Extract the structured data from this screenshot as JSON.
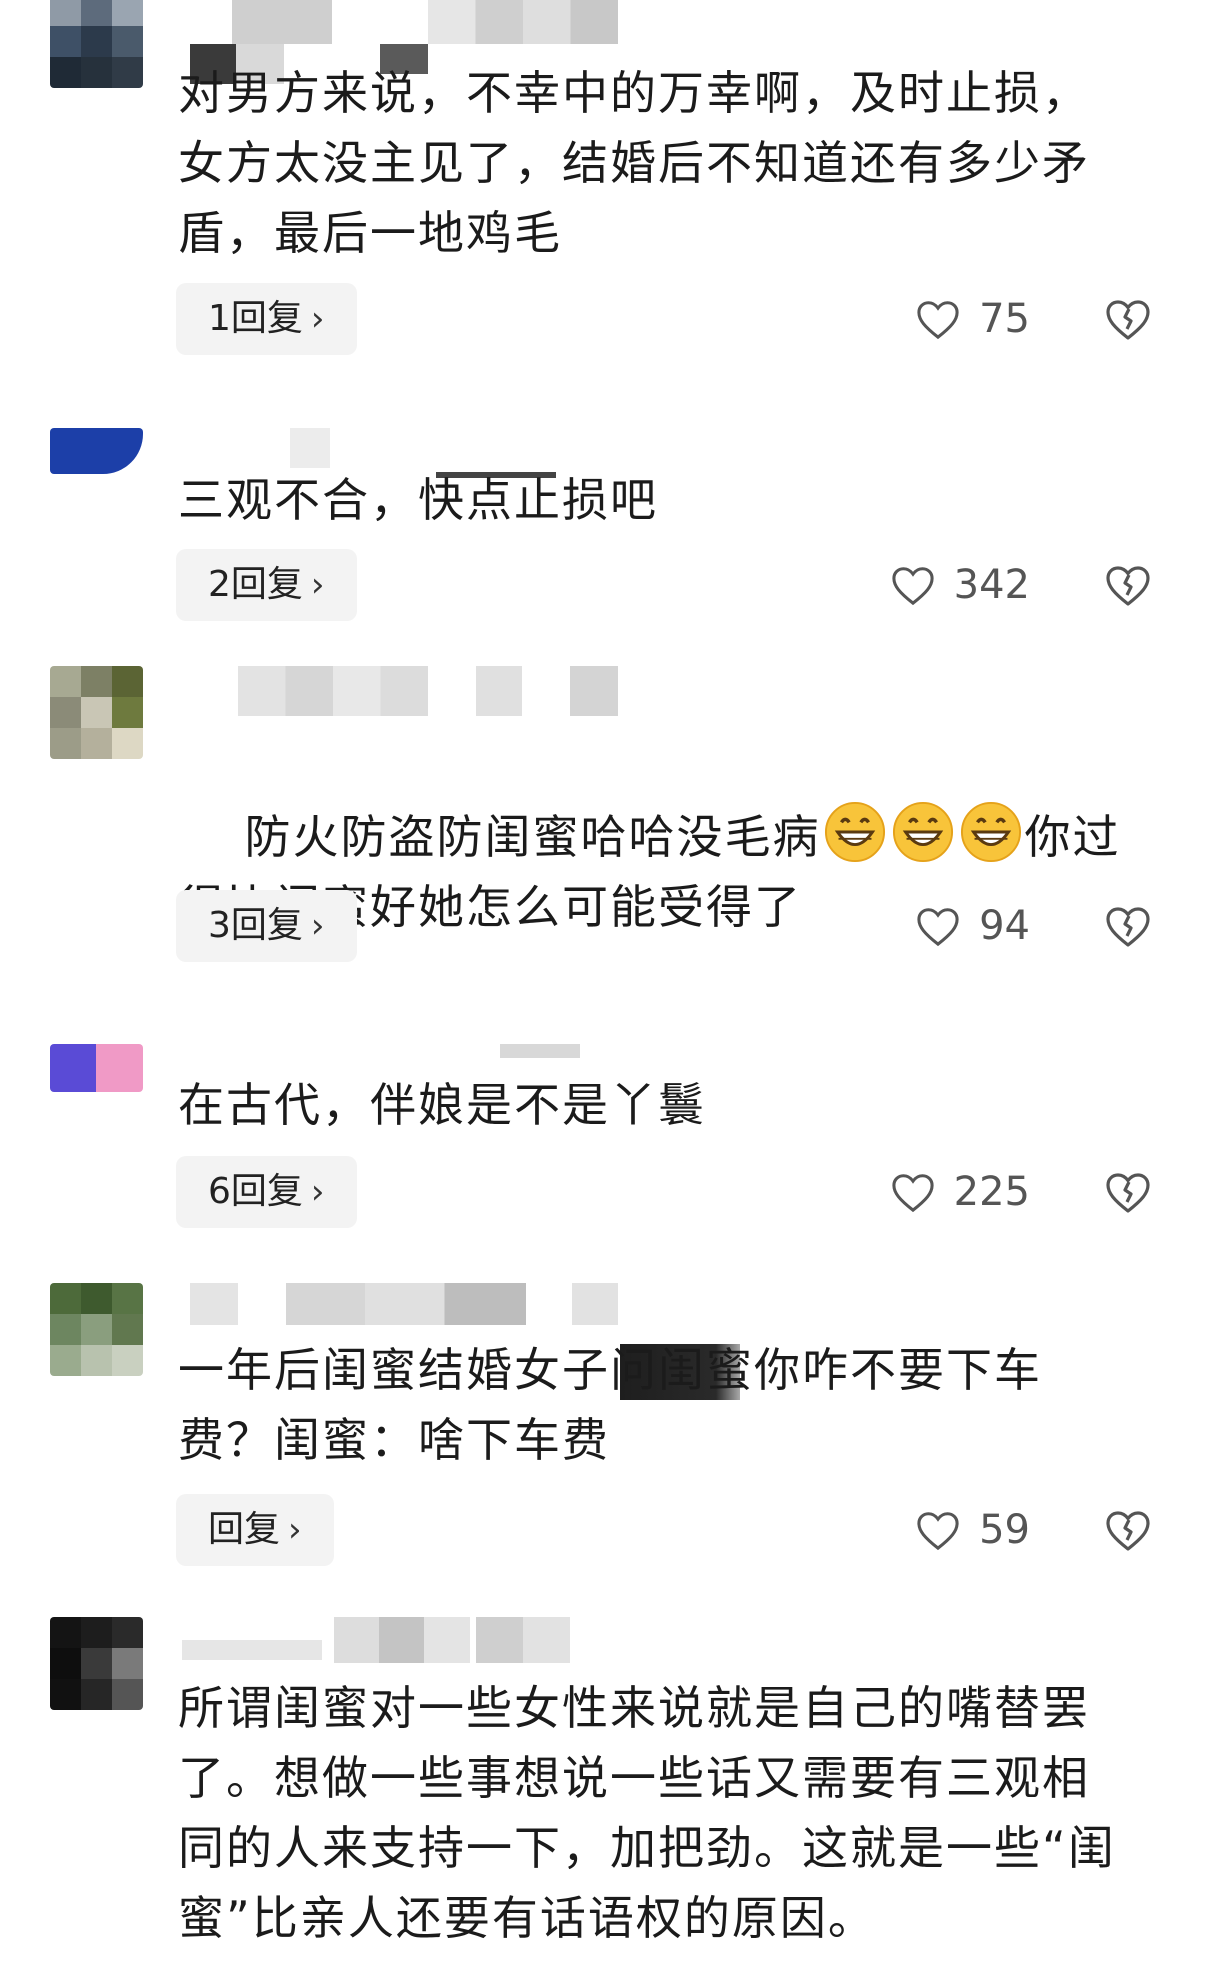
{
  "comments": [
    {
      "text": "对男方来说，不幸中的万幸啊，及时止损，女方太没主见了，结婚后不知道还有多少矛盾，最后一地鸡毛",
      "reply_label": "1回复",
      "likes": "75"
    },
    {
      "text": "三观不合，快点止损吧",
      "reply_label": "2回复",
      "likes": "342"
    },
    {
      "text_before": "防火防盗防闺蜜哈哈没毛病",
      "text_after": "你过得比闺蜜好她怎么可能受得了",
      "reply_label": "3回复",
      "likes": "94"
    },
    {
      "text": "在古代，伴娘是不是丫鬟",
      "reply_label": "6回复",
      "likes": "225"
    },
    {
      "text": "一年后闺蜜结婚女子问闺蜜你咋不要下车费？闺蜜：啥下车费",
      "reply_label": "回复",
      "likes": "59"
    },
    {
      "text": "所谓闺蜜对一些女性来说就是自己的嘴替罢了。想做一些事想说一些话又需要有三观相同的人来支持一下，加把劲。这就是一些“闺蜜”比亲人还要有话语权的原因。"
    }
  ],
  "icons": {
    "like": "heart-outline-icon",
    "dislike": "broken-heart-icon",
    "reply_arrow": "chevron-right-icon",
    "emoji": "grinning-face-icon"
  },
  "colors": {
    "background": "#ffffff",
    "text": "#1b1b1b",
    "reply_bg": "#f3f3f3",
    "icon": "#555555"
  }
}
